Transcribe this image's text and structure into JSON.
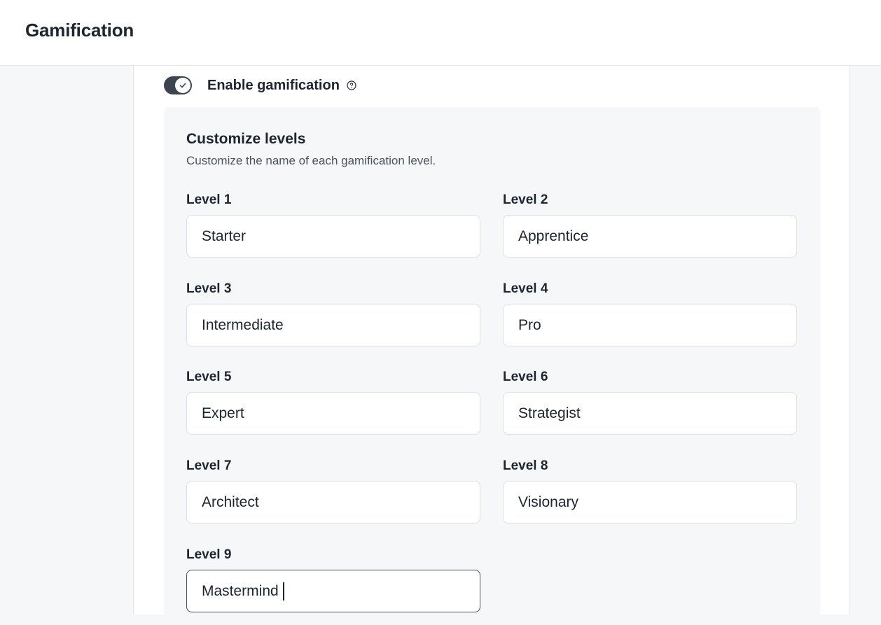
{
  "header": {
    "title": "Gamification"
  },
  "toggle": {
    "label": "Enable gamification",
    "enabled": true,
    "help_icon": "question-circle-icon"
  },
  "levels_panel": {
    "heading": "Customize levels",
    "subheading": "Customize the name of each gamification level.",
    "levels": [
      {
        "label": "Level 1",
        "value": "Starter"
      },
      {
        "label": "Level 2",
        "value": "Apprentice"
      },
      {
        "label": "Level 3",
        "value": "Intermediate"
      },
      {
        "label": "Level 4",
        "value": "Pro"
      },
      {
        "label": "Level 5",
        "value": "Expert"
      },
      {
        "label": "Level 6",
        "value": "Strategist"
      },
      {
        "label": "Level 7",
        "value": "Architect"
      },
      {
        "label": "Level 8",
        "value": "Visionary"
      },
      {
        "label": "Level 9",
        "value": "Mastermind"
      }
    ],
    "focused_level": 9
  },
  "colors": {
    "toggle_on": "#3d4450",
    "panel_bg": "#f6f7f9",
    "text": "#1d2530"
  }
}
